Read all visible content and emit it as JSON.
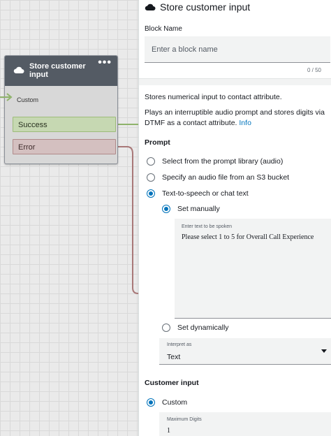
{
  "canvas": {
    "block": {
      "title": "Store customer input",
      "menu": "•••",
      "entry_label": "Custom",
      "branches": {
        "success": "Success",
        "error": "Error"
      }
    }
  },
  "panel": {
    "title": "Store customer input",
    "block_name": {
      "label": "Block Name",
      "placeholder": "Enter a block name",
      "value": "",
      "counter": "0 / 50"
    },
    "description": {
      "line1": "Stores numerical input to contact attribute.",
      "line2": "Plays an interruptible audio prompt and stores digits via DTMF as a contact attribute.",
      "info_link": "Info"
    },
    "prompt": {
      "heading": "Prompt",
      "options": [
        {
          "label": "Select from the prompt library (audio)",
          "selected": false
        },
        {
          "label": "Specify an audio file from an S3 bucket",
          "selected": false
        },
        {
          "label": "Text-to-speech or chat text",
          "selected": true
        }
      ],
      "sub_options": {
        "set_manually": "Set manually",
        "set_dynamically": "Set dynamically"
      },
      "text_field": {
        "label": "Enter text to be spoken",
        "value": "Please select 1 to 5 for Overall Call Experience"
      },
      "interpret_as": {
        "label": "Interpret as",
        "value": "Text"
      }
    },
    "customer_input": {
      "heading": "Customer input",
      "custom_label": "Custom",
      "max_digits": {
        "label": "Maximum Digits",
        "value": "1"
      }
    }
  },
  "colors": {
    "accent": "#0073bb",
    "block_header": "#545b64",
    "success_connector": "#8fb36b",
    "error_connector": "#a87878"
  }
}
